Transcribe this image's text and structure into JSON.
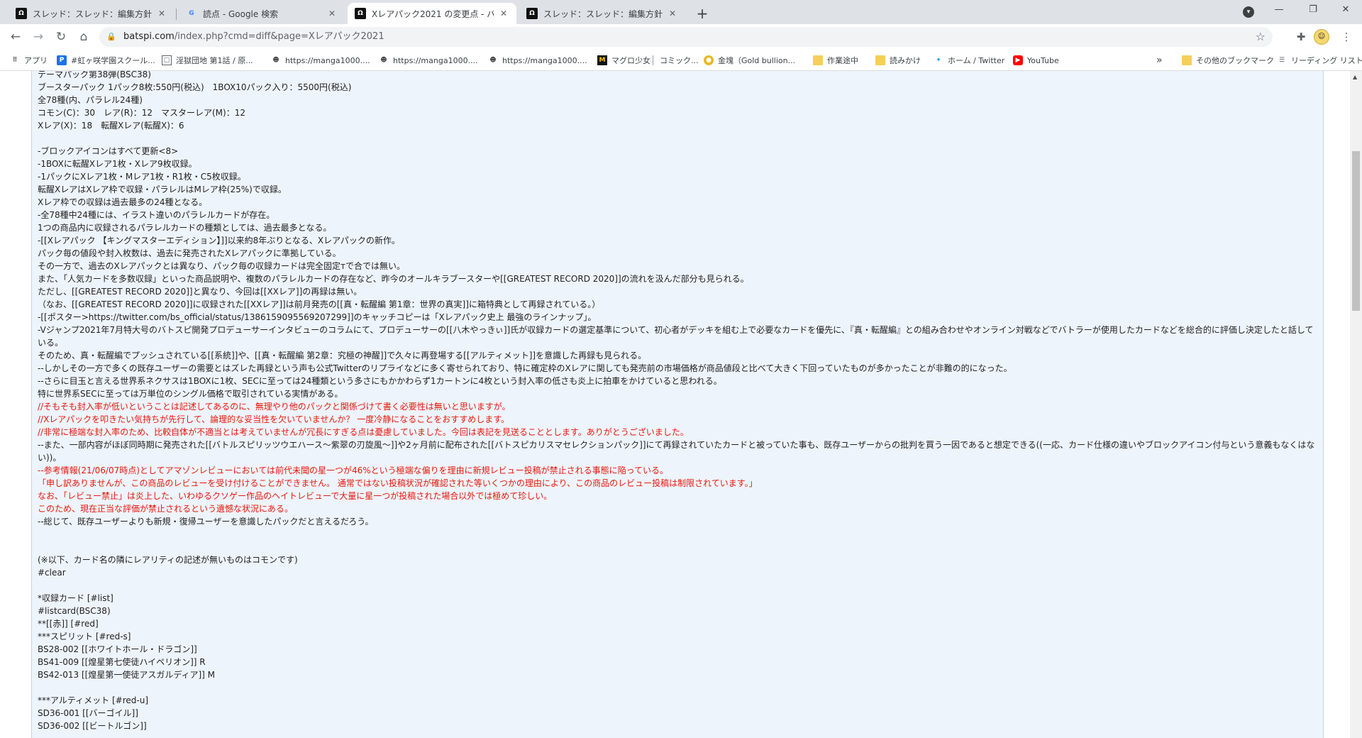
{
  "tabs": [
    {
      "title": "スレッド：スレッド：編集方針・記述"
    },
    {
      "title": "読点 - Google 検索"
    },
    {
      "title": "Xレアパック2021 の変更点 - バトルス"
    },
    {
      "title": "スレッド：スレッド：編集方針・記述"
    }
  ],
  "address": {
    "host": "batspi.com",
    "path": "/index.php?cmd=diff&page=Xレアパック2021"
  },
  "bookmarks": [
    {
      "label": "アプリ",
      "icon": "apps-icon"
    },
    {
      "label": "#虹ヶ咲学園スクール...",
      "icon": "bookmark-icon"
    },
    {
      "label": "淫獄団地 第1話 / 原...",
      "icon": "frame-icon"
    },
    {
      "label": "https://manga1000....",
      "icon": "manga-icon"
    },
    {
      "label": "https://manga1000....",
      "icon": "manga-icon"
    },
    {
      "label": "https://manga1000....",
      "icon": "manga-icon"
    },
    {
      "label": "マグロ少女",
      "icon": "site-icon"
    },
    {
      "label": "コミック...",
      "icon": "comic-icon"
    },
    {
      "label": "金塊（Gold bullion...",
      "icon": "gold-icon"
    },
    {
      "label": "作業途中",
      "icon": "folder-icon"
    },
    {
      "label": "読みかけ",
      "icon": "folder-icon"
    },
    {
      "label": "ホーム / Twitter",
      "icon": "twitter-icon"
    },
    {
      "label": "YouTube",
      "icon": "youtube-icon"
    }
  ],
  "bookmarks_overflow": "»",
  "other_bookmarks": "その他のブックマーク",
  "reading_list": "リーディング リスト",
  "lines": [
    {
      "text": "テーマパック第38弾(BSC38)",
      "red": false
    },
    {
      "text": "ブースターパック 1パック8枚:550円(税込)　1BOX10パック入り：5500円(税込)",
      "red": false
    },
    {
      "text": "全78種(内、パラレル24種)",
      "red": false
    },
    {
      "text": "コモン(C)：30　レア(R)：12　マスターレア(M)：12",
      "red": false
    },
    {
      "text": "Xレア(X)：18　転醒Xレア(転醒X)：6",
      "red": false
    },
    {
      "text": "",
      "red": false
    },
    {
      "text": "-ブロックアイコンはすべて更新<8>",
      "red": false
    },
    {
      "text": "-1BOXに転醒Xレア1枚・Xレア9枚収録。",
      "red": false
    },
    {
      "text": "-1パックにXレア1枚・Mレア1枚・R1枚・C5枚収録。",
      "red": false
    },
    {
      "text": "転醒XレアはXレア枠で収録・パラレルはMレア枠(25%)で収録。",
      "red": false
    },
    {
      "text": "Xレア枠での収録は過去最多の24種となる。",
      "red": false
    },
    {
      "text": "-全78種中24種には、イラスト違いのパラレルカードが存在。",
      "red": false
    },
    {
      "text": "1つの商品内に収録されるパラレルカードの種類としては、過去最多となる。",
      "red": false
    },
    {
      "text": "-[[Xレアパック 【キングマスターエディション】]]以来約8年ぶりとなる、Xレアパックの新作。",
      "red": false
    },
    {
      "text": "パック毎の値段や封入枚数は、過去に発売されたXレアパックに準拠している。",
      "red": false
    },
    {
      "text": "その一方で、過去のXレアパックとは異なり、パック毎の収録カードは完全固定тで合では無い。",
      "red": false
    },
    {
      "text": "また、「人気カードを多数収録」といった商品説明や、複数のパラレルカードの存在など、昨今のオールキラブースターや[[GREATEST RECORD 2020]]の流れを汲んだ部分も見られる。",
      "red": false
    },
    {
      "text": "ただし、[[GREATEST RECORD 2020]]と異なり、今回は[[XXレア]]の再録は無い。",
      "red": false
    },
    {
      "text": "（なお、[[GREATEST RECORD 2020]]に収録された[[XXレア]]は前月発売の[[真・転醒編 第1章：世界の真実]]に箱特典として再録されている。）",
      "red": false
    },
    {
      "text": "-[[ポスター>https://twitter.com/bs_official/status/1386159095569207299]]のキャッチコピーは「Xレアパック史上 最強のラインナップ」。",
      "red": false
    },
    {
      "text": "-Vジャンプ2021年7月特大号のバトスピ開発プロデューサーインタビューのコラムにて、プロデューサーの[[八木やっきぃ]]氏が収録カードの選定基準について、初心者がデッキを組む上で必要なカードを優先に、『真・転醒編』との組み合わせやオンライン対戦などでバトラーが使用したカードなどを総合的に評価し決定したと話している。",
      "red": false
    },
    {
      "text": "そのため、真・転醒編でプッシュされている[[系統]]や、[[真・転醒編 第2章：究極の神醒]]で久々に再登場する[[アルティメット]]を意識した再録も見られる。",
      "red": false
    },
    {
      "text": "--しかしその一方で多くの既存ユーザーの需要とはズレた再録という声も公式Twitterのリプライなどに多く寄せられており、特に確定枠のXレアに関しても発売前の市場価格が商品値段と比べて大きく下回っていたものが多かったことが非難の的になった。",
      "red": false
    },
    {
      "text": "--さらに目玉と言える世界系ネクサスは1BOXに1枚、SECに至っては24種類という多さにもかかわらず1カートンに4枚という封入率の低さも炎上に拍車をかけていると思われる。",
      "red": false
    },
    {
      "text": "特に世界系SECに至っては万単位のシングル価格で取引されている実情がある。",
      "red": false
    },
    {
      "text": "//そもそも封入率が低いということは記述してあるのに、無理やり他のパックと関係づけて書く必要性は無いと思いますが。",
      "red": true
    },
    {
      "text": "//Xレアパックを叩きたい気持ちが先行して、論理的な妥当性を欠いていませんか？ 一度冷静になることをおすすめします。",
      "red": true
    },
    {
      "text": "//非常に極端な封入率のため、比較自体が不適当とは考えていませんが冗長にすぎる点は憂慮していました。今回は表記を見送ることとします。ありがとうございました。",
      "red": true
    },
    {
      "text": "--また、一部内容がほぼ同時期に発売された[[バトルスピリッツウエハース～紫翠の刃旋風～]]や2ヶ月前に配布された[[バトスピカリスマセレクションパック]]にて再録されていたカードと被っていた事も、既存ユーザーからの批判を買う一因であると想定できる((一応、カード仕様の違いやブロックアイコン付与という意義もなくはない))。",
      "red": false
    },
    {
      "text": "--参考情報(21/06/07時点)としてアマゾンレビューにおいては前代未聞の星一つが46%という極端な偏りを理由に新規レビュー投稿が禁止される事態に陥っている。",
      "red": true
    },
    {
      "text": "「申し訳ありませんが、この商品のレビューを受け付けることができません。 通常ではない投稿状況が確認された等いくつかの理由により、この商品のレビュー投稿は制限されています。」",
      "red": true
    },
    {
      "text": "なお、「レビュー禁止」は炎上した、いわゆるクソゲー作品のヘイトレビューで大量に星一つが投稿された場合以外では極めて珍しい。",
      "red": true
    },
    {
      "text": "このため、現在正当な評価が禁止されるという遺憾な状況にある。",
      "red": true
    },
    {
      "text": "--総じて、既存ユーザーよりも新規・復帰ユーザーを意識したパックだと言えるだろう。",
      "red": false
    },
    {
      "text": "",
      "red": false
    },
    {
      "text": "",
      "red": false
    },
    {
      "text": "(※以下、カード名の隣にレアリティの記述が無いものはコモンです)",
      "red": false
    },
    {
      "text": "#clear",
      "red": false
    },
    {
      "text": "",
      "red": false
    },
    {
      "text": "*収録カード [#list]",
      "red": false
    },
    {
      "text": "#listcard(BSC38)",
      "red": false
    },
    {
      "text": "**[[赤]] [#red]",
      "red": false
    },
    {
      "text": "***スピリット [#red-s]",
      "red": false
    },
    {
      "text": "BS28-002 [[ホワイトホール・ドラゴン]]",
      "red": false
    },
    {
      "text": "BS41-009 [[煌星第七使徒ハイペリオン]] R",
      "red": false
    },
    {
      "text": "BS42-013 [[煌星第一使徒アスガルディア]] M",
      "red": false
    },
    {
      "text": "",
      "red": false
    },
    {
      "text": "***アルティメット [#red-u]",
      "red": false
    },
    {
      "text": "SD36-001 [[バーゴイル]]",
      "red": false
    },
    {
      "text": "SD36-002 [[ビートルゴン]]",
      "red": false
    }
  ]
}
